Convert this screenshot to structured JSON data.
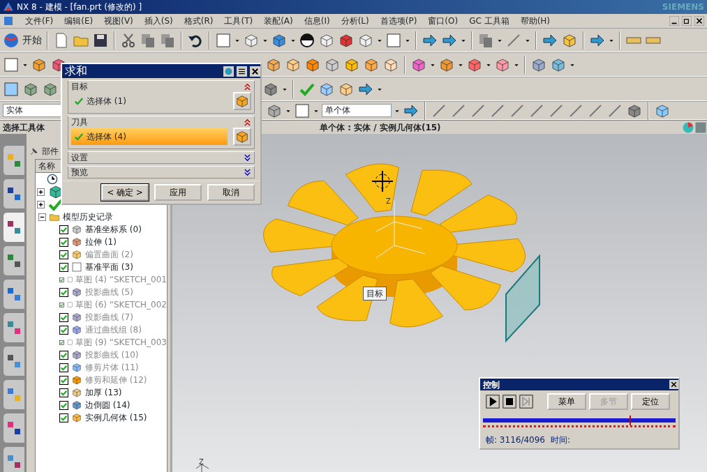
{
  "window": {
    "title": "NX 8 - 建模 - [fan.prt (修改的) ]",
    "brand": "SIEMENS"
  },
  "menu": [
    "文件(F)",
    "编辑(E)",
    "视图(V)",
    "插入(S)",
    "格式(R)",
    "工具(T)",
    "装配(A)",
    "信息(I)",
    "分析(L)",
    "首选项(P)",
    "窗口(O)",
    "GC 工具箱",
    "帮助(H)"
  ],
  "toolbar": {
    "start_label": "开始",
    "type_filter": "实体",
    "body_filter": "单个体"
  },
  "prompt": "选择工具体",
  "selection_status": "单个体 : 实体 / 实例几何体(15)",
  "resource_tabs": [
    {
      "selected": false
    },
    {
      "selected": false
    },
    {
      "selected": true
    },
    {
      "selected": false
    },
    {
      "selected": false
    },
    {
      "selected": false
    },
    {
      "selected": false
    },
    {
      "selected": false
    },
    {
      "selected": false
    },
    {
      "selected": false
    }
  ],
  "navigator": {
    "title": "部件",
    "column": "名称",
    "history": {
      "label": "模型历史记录",
      "expanded": true,
      "children": [
        {
          "label": "基准坐标系 (0)",
          "checked": true,
          "dimmed": false
        },
        {
          "label": "拉伸 (1)",
          "checked": true,
          "dimmed": false
        },
        {
          "label": "偏置曲面 (2)",
          "checked": true,
          "dimmed": true
        },
        {
          "label": "基准平面 (3)",
          "checked": true,
          "dimmed": false
        },
        {
          "label": "草图 (4) “SKETCH_001",
          "checked": true,
          "dimmed": true
        },
        {
          "label": "投影曲线 (5)",
          "checked": true,
          "dimmed": true
        },
        {
          "label": "草图 (6) “SKETCH_002",
          "checked": true,
          "dimmed": true
        },
        {
          "label": "投影曲线 (7)",
          "checked": true,
          "dimmed": true
        },
        {
          "label": "通过曲线组 (8)",
          "checked": true,
          "dimmed": true
        },
        {
          "label": "草图 (9) “SKETCH_003",
          "checked": true,
          "dimmed": true
        },
        {
          "label": "投影曲线 (10)",
          "checked": true,
          "dimmed": true
        },
        {
          "label": "修剪片体 (11)",
          "checked": true,
          "dimmed": true
        },
        {
          "label": "修剪和延伸 (12)",
          "checked": true,
          "dimmed": true
        },
        {
          "label": "加厚 (13)",
          "checked": true,
          "dimmed": false
        },
        {
          "label": "边倒圆 (14)",
          "checked": true,
          "dimmed": false
        },
        {
          "label": "实例几何体 (15)",
          "checked": true,
          "dimmed": false
        }
      ]
    }
  },
  "dialog": {
    "title": "求和",
    "sections": [
      {
        "title": "目标",
        "expanded": true,
        "selected": false,
        "row": "选择体 (1)"
      },
      {
        "title": "刀具",
        "expanded": true,
        "selected": true,
        "row": "选择体 (4)"
      },
      {
        "title": "设置",
        "expanded": false
      },
      {
        "title": "预览",
        "expanded": false
      }
    ],
    "buttons": [
      {
        "label": "< 确定 >",
        "default": true
      },
      {
        "label": "应用",
        "default": false
      },
      {
        "label": "取消",
        "default": false
      }
    ]
  },
  "viewport": {
    "tooltip": "目标",
    "axis_labels": [
      "Z",
      "Z"
    ]
  },
  "control_panel": {
    "title": "控制",
    "buttons": [
      {
        "label": "菜单",
        "disabled": false
      },
      {
        "label": "多节",
        "disabled": true
      },
      {
        "label": "定位",
        "disabled": false
      }
    ],
    "level": 0.76,
    "frame": "帧: 3116/4096",
    "time": "时间:"
  }
}
